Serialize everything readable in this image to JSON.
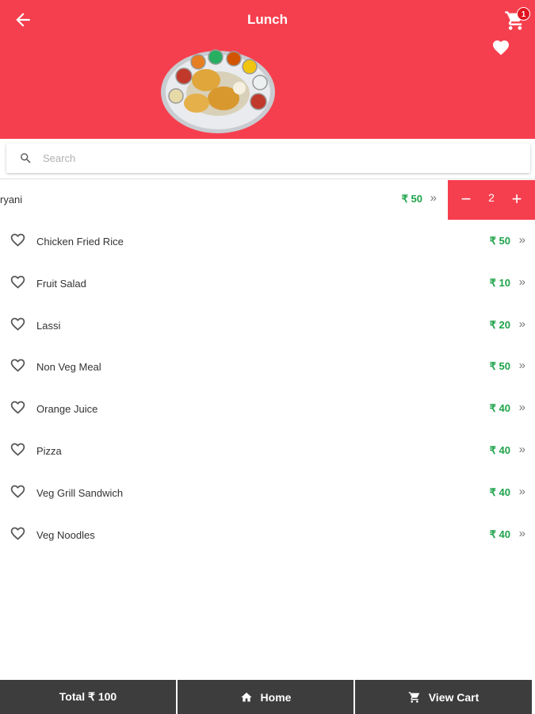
{
  "header": {
    "title": "Lunch",
    "cart_count": "1",
    "background_color": "#f63f4e",
    "back_icon": "arrow-left-icon",
    "cart_icon": "cart-icon",
    "favorite_icon": "heart-filled-icon"
  },
  "search": {
    "placeholder": "Search",
    "value": ""
  },
  "swiped_item": {
    "name": "ryani",
    "price": "₹ 50",
    "chevron": "»",
    "quantity": "2",
    "minus_label": "−",
    "plus_label": "+"
  },
  "items": [
    {
      "name": "Chicken Fried Rice",
      "price": "₹ 50",
      "chevron": "»"
    },
    {
      "name": "Fruit Salad",
      "price": "₹ 10",
      "chevron": "»"
    },
    {
      "name": "Lassi",
      "price": "₹ 20",
      "chevron": "»"
    },
    {
      "name": "Non Veg Meal",
      "price": "₹ 50",
      "chevron": "»"
    },
    {
      "name": "Orange Juice",
      "price": "₹ 40",
      "chevron": "»"
    },
    {
      "name": "Pizza",
      "price": "₹ 40",
      "chevron": "»"
    },
    {
      "name": "Veg Grill Sandwich",
      "price": "₹ 40",
      "chevron": "»"
    },
    {
      "name": "Veg Noodles",
      "price": "₹ 40",
      "chevron": "»"
    }
  ],
  "bottom_bar": {
    "total_label": "Total ₹ 100",
    "home_label": "Home",
    "view_cart_label": "View Cart",
    "background_color": "#3d3d3d"
  },
  "colors": {
    "accent": "#f63f4e",
    "price": "#1ea34a"
  }
}
